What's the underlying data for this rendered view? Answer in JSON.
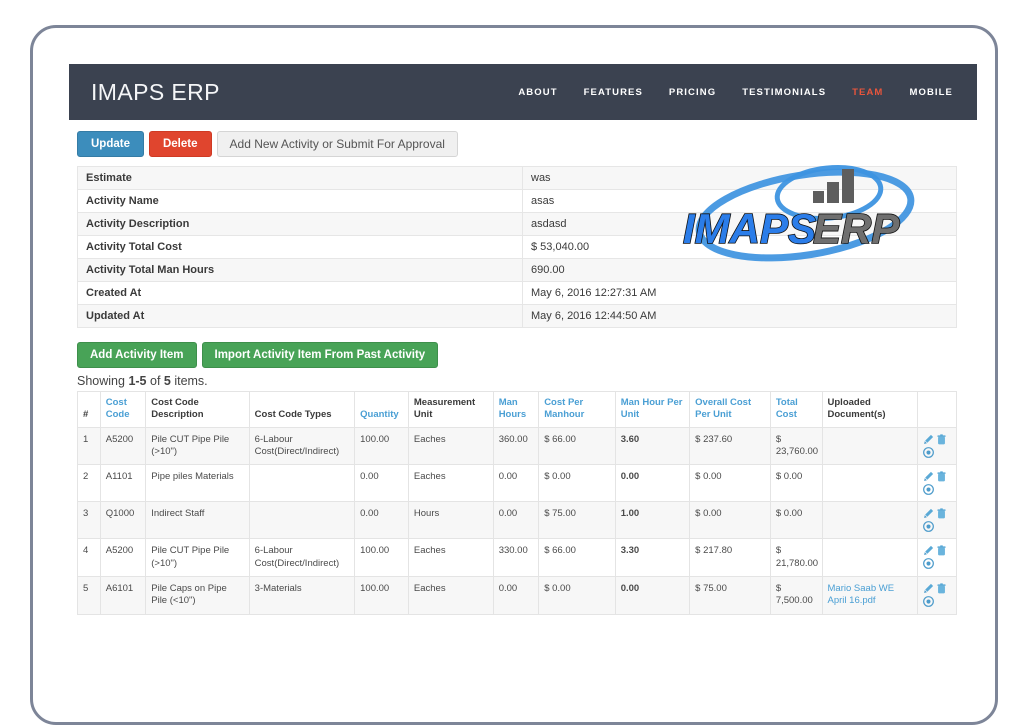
{
  "navbar": {
    "brand": "IMAPS ERP",
    "links": [
      {
        "label": "ABOUT",
        "active": false
      },
      {
        "label": "FEATURES",
        "active": false
      },
      {
        "label": "PRICING",
        "active": false
      },
      {
        "label": "TESTIMONIALS",
        "active": false
      },
      {
        "label": "TEAM",
        "active": true
      },
      {
        "label": "MOBILE",
        "active": false
      }
    ],
    "active_color": "#e8553c",
    "background": "#3b4250"
  },
  "action_bar": {
    "update_label": "Update",
    "delete_label": "Delete",
    "add_new_label": "Add New Activity or Submit For Approval",
    "update_color": "#3c8dbc",
    "delete_color": "#e0452e"
  },
  "details": {
    "rows": [
      {
        "label": "Estimate",
        "value": "was",
        "is_link": true
      },
      {
        "label": "Activity Name",
        "value": "asas",
        "is_link": false
      },
      {
        "label": "Activity Description",
        "value": "asdasd",
        "is_link": false
      },
      {
        "label": "Activity Total Cost",
        "value": "$ 53,040.00",
        "is_link": false
      },
      {
        "label": "Activity Total Man Hours",
        "value": "690.00",
        "is_link": false
      },
      {
        "label": "Created At",
        "value": "May 6, 2016 12:27:31 AM",
        "is_link": false
      },
      {
        "label": "Updated At",
        "value": "May 6, 2016 12:44:50 AM",
        "is_link": false
      }
    ]
  },
  "watermark": {
    "text_primary": "IMAPS",
    "text_secondary": "ERP",
    "primary_color": "#2b7de9",
    "secondary_color": "#6f6f6f",
    "swoosh_color": "#3d93e0"
  },
  "items_toolbar": {
    "add_item_label": "Add Activity Item",
    "import_item_label": "Import Activity Item From Past Activity",
    "green_color": "#48a357"
  },
  "showing": {
    "prefix": "Showing ",
    "range": "1-5",
    "middle": " of ",
    "total": "5",
    "suffix": " items."
  },
  "items_table": {
    "columns": [
      {
        "label": "#",
        "link": false
      },
      {
        "label": "Cost Code",
        "link": true
      },
      {
        "label": "Cost Code Description",
        "link": false
      },
      {
        "label": "Cost Code Types",
        "link": false
      },
      {
        "label": "Quantity",
        "link": true
      },
      {
        "label": "Measurement Unit",
        "link": false
      },
      {
        "label": "Man Hours",
        "link": true
      },
      {
        "label": "Cost Per Manhour",
        "link": true
      },
      {
        "label": "Man Hour Per Unit",
        "link": true
      },
      {
        "label": "Overall Cost Per Unit",
        "link": true
      },
      {
        "label": "Total Cost",
        "link": true
      },
      {
        "label": "Uploaded Document(s)",
        "link": false
      },
      {
        "label": "",
        "link": false
      }
    ],
    "rows": [
      {
        "index": "1",
        "cost_code": "A5200",
        "description": "Pile CUT Pipe Pile (>10\")",
        "types": "6-Labour Cost(Direct/Indirect)",
        "quantity": "100.00",
        "unit": "Eaches",
        "man_hours": "360.00",
        "cost_per_manhour": "$ 66.00",
        "man_hour_per_unit": "3.60",
        "overall_cost_per_unit": "$ 237.60",
        "total_cost": "$ 23,760.00",
        "document": ""
      },
      {
        "index": "2",
        "cost_code": "A1101",
        "description": "Pipe piles Materials",
        "types": "",
        "quantity": "0.00",
        "unit": "Eaches",
        "man_hours": "0.00",
        "cost_per_manhour": "$ 0.00",
        "man_hour_per_unit": "0.00",
        "overall_cost_per_unit": "$ 0.00",
        "total_cost": "$ 0.00",
        "document": ""
      },
      {
        "index": "3",
        "cost_code": "Q1000",
        "description": "Indirect Staff",
        "types": "",
        "quantity": "0.00",
        "unit": "Hours",
        "man_hours": "0.00",
        "cost_per_manhour": "$ 75.00",
        "man_hour_per_unit": "1.00",
        "overall_cost_per_unit": "$ 0.00",
        "total_cost": "$ 0.00",
        "document": ""
      },
      {
        "index": "4",
        "cost_code": "A5200",
        "description": "Pile CUT Pipe Pile (>10\")",
        "types": "6-Labour Cost(Direct/Indirect)",
        "quantity": "100.00",
        "unit": "Eaches",
        "man_hours": "330.00",
        "cost_per_manhour": "$ 66.00",
        "man_hour_per_unit": "3.30",
        "overall_cost_per_unit": "$ 217.80",
        "total_cost": "$ 21,780.00",
        "document": ""
      },
      {
        "index": "5",
        "cost_code": "A6101",
        "description": "Pile Caps on Pipe Pile (<10\")",
        "types": "3-Materials",
        "quantity": "100.00",
        "unit": "Eaches",
        "man_hours": "0.00",
        "cost_per_manhour": "$ 0.00",
        "man_hour_per_unit": "0.00",
        "overall_cost_per_unit": "$ 75.00",
        "total_cost": "$ 7,500.00",
        "document": "Mario Saab WE April 16.pdf"
      }
    ],
    "row_actions": [
      {
        "name": "edit-icon",
        "title": "Edit"
      },
      {
        "name": "delete-icon",
        "title": "Delete"
      },
      {
        "name": "info-icon",
        "title": "Details"
      }
    ],
    "link_color": "#4a9fd4"
  }
}
